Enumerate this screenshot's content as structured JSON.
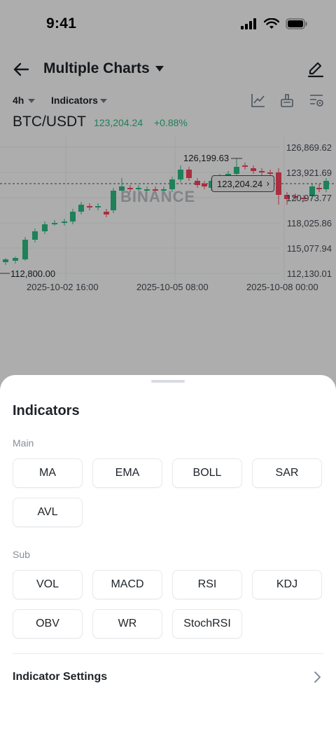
{
  "status_bar": {
    "time": "9:41"
  },
  "header": {
    "title": "Multiple Charts"
  },
  "toolbar": {
    "timeframe": "4h",
    "indicators_label": "Indicators"
  },
  "ticker": {
    "pair": "BTC/USDT",
    "price": "123,204.24",
    "change": "+0.88%"
  },
  "chart": {
    "y_ticks": [
      "126,869.62",
      "123,921.69",
      "120,973.77",
      "118,025.86",
      "115,077.94",
      "112,130.01"
    ],
    "x_ticks": [
      "2025-10-02 16:00",
      "2025-10-05 08:00",
      "2025-10-08 00:00"
    ],
    "high_label": "126,199.63",
    "low_label": "112,800.00",
    "current_price_tag": "123,204.24",
    "watermark": "BINANCE",
    "colors": {
      "up": "#2ebd85",
      "down": "#f6465d"
    }
  },
  "sheet": {
    "title": "Indicators",
    "main_label": "Main",
    "main_items": [
      "MA",
      "EMA",
      "BOLL",
      "SAR",
      "AVL"
    ],
    "sub_label": "Sub",
    "sub_items": [
      "VOL",
      "MACD",
      "RSI",
      "KDJ",
      "OBV",
      "WR",
      "StochRSI"
    ],
    "settings_label": "Indicator Settings"
  }
}
